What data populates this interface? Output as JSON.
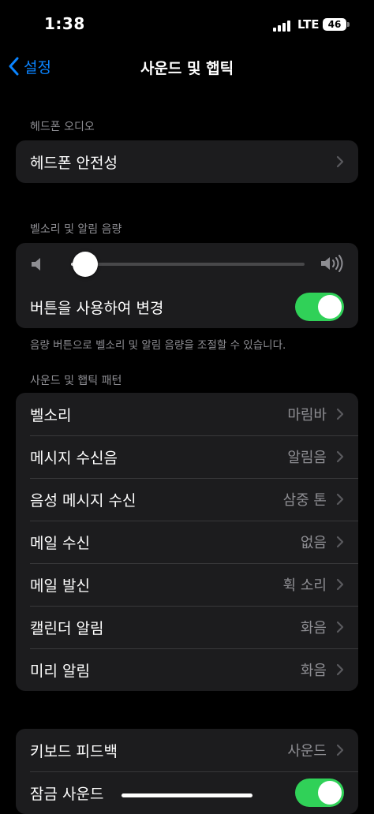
{
  "status_bar": {
    "time": "1:38",
    "network": "LTE",
    "battery": "46"
  },
  "nav": {
    "back_label": "설정",
    "title": "사운드 및 햅틱"
  },
  "headphone": {
    "header": "헤드폰 오디오",
    "rows": [
      {
        "label": "헤드폰 안전성"
      }
    ]
  },
  "ringer": {
    "header": "벨소리 및 알림 음량",
    "volume_level": 0.06,
    "toggle_label": "버튼을 사용하여 변경",
    "toggle_on": true,
    "footer": "음량 버튼으로 벨소리 및 알림 음량을 조절할 수 있습니다."
  },
  "patterns": {
    "header": "사운드 및 햅틱 패턴",
    "rows": [
      {
        "label": "벨소리",
        "value": "마림바"
      },
      {
        "label": "메시지 수신음",
        "value": "알림음"
      },
      {
        "label": "음성 메시지 수신",
        "value": "삼중 톤"
      },
      {
        "label": "메일 수신",
        "value": "없음"
      },
      {
        "label": "메일 발신",
        "value": "휙 소리"
      },
      {
        "label": "캘린더 알림",
        "value": "화음"
      },
      {
        "label": "미리 알림",
        "value": "화음"
      }
    ]
  },
  "system": {
    "rows": [
      {
        "label": "키보드 피드백",
        "value": "사운드"
      },
      {
        "label": "잠금 사운드",
        "toggle_on": true
      }
    ]
  },
  "colors": {
    "accent": "#0a84ff",
    "toggle_on": "#30d158",
    "cell_bg": "#1c1c1e",
    "secondary_text": "#8e8e93"
  }
}
